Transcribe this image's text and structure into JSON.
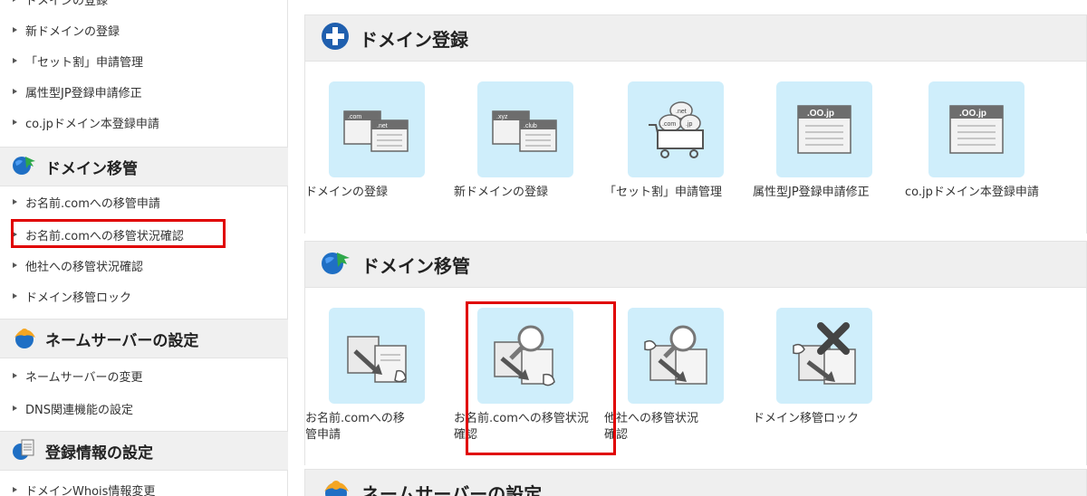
{
  "sidebar": {
    "top_items": [
      "ドメインの登録",
      "新ドメインの登録",
      "「セット割」申請管理",
      "属性型JP登録申請修正",
      "co.jpドメイン本登録申請"
    ],
    "sections": [
      {
        "title": "ドメイン移管",
        "items": [
          "お名前.comへの移管申請",
          "お名前.comへの移管状況確認",
          "他社への移管状況確認",
          "ドメイン移管ロック"
        ]
      },
      {
        "title": "ネームサーバーの設定",
        "items": [
          "ネームサーバーの変更",
          "DNS関連機能の設定"
        ]
      },
      {
        "title": "登録情報の設定",
        "items": [
          "ドメインWhois情報変更"
        ]
      }
    ],
    "highlighted_item": "お名前.comへの移管状況確認"
  },
  "main": {
    "panels": [
      {
        "title": "ドメイン登録",
        "tiles": [
          {
            "label": "ドメインの登録",
            "icon": "domain-register-icon",
            "tags": [
              ".com",
              ".net"
            ]
          },
          {
            "label": "新ドメインの登録",
            "icon": "new-domain-register-icon",
            "tags": [
              ".xyz",
              ".club"
            ]
          },
          {
            "label": "「セット割」申請管理",
            "icon": "cart-icon",
            "tags": [
              ".net",
              ".com",
              ".jp"
            ]
          },
          {
            "label": "属性型JP登録申請修正",
            "icon": "jp-domain-icon",
            "tags": [
              ".OO.jp"
            ]
          },
          {
            "label": "co.jpドメイン本登録申請",
            "icon": "cojp-domain-icon",
            "tags": [
              ".OO.jp"
            ]
          }
        ]
      },
      {
        "title": "ドメイン移管",
        "tiles": [
          {
            "label": "お名前.comへの移管申請",
            "icon": "transfer-in-icon"
          },
          {
            "label": "お名前.comへの移管状況確認",
            "icon": "transfer-status-icon"
          },
          {
            "label": "他社への移管状況確認",
            "icon": "transfer-out-status-icon"
          },
          {
            "label": "ドメイン移管ロック",
            "icon": "transfer-lock-icon"
          }
        ]
      },
      {
        "title": "ネームサーバーの設定"
      }
    ]
  },
  "colors": {
    "highlight": "#e00000",
    "tile_bg": "#cfeefb",
    "header_bg": "#efefef",
    "globe_blue": "#1f6fc4",
    "globe_green": "#2ea84a",
    "plus_icon": "#1f5fae"
  }
}
